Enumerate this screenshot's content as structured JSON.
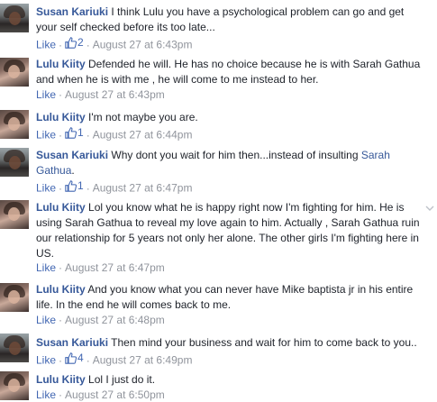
{
  "comments": [
    {
      "author": "Susan Kariuki",
      "avatar": "susan",
      "text": "I think Lulu you have a psychological problem can go and get your self checked before its too late...",
      "like_label": "Like",
      "reactions": "2",
      "timestamp": "August 27 at 6:43pm"
    },
    {
      "author": "Lulu Kiity",
      "avatar": "lulu",
      "text": "Defended he will. He has no choice because he is with Sarah Gathua and when he is with me , he will come to me instead to her.",
      "like_label": "Like",
      "reactions": "",
      "timestamp": "August 27 at 6:43pm"
    },
    {
      "author": "Lulu Kiity",
      "avatar": "lulu",
      "text": "I'm not maybe you are.",
      "like_label": "Like",
      "reactions": "1",
      "timestamp": "August 27 at 6:44pm"
    },
    {
      "author": "Susan Kariuki",
      "avatar": "susan",
      "text": "Why dont you wait for him then...instead of insulting ",
      "mention": "Sarah Gathua",
      "text_after": ".",
      "like_label": "Like",
      "reactions": "1",
      "timestamp": "August 27 at 6:47pm"
    },
    {
      "author": "Lulu Kiity",
      "avatar": "lulu",
      "text": "Lol you know what he is happy right now I'm fighting for him. He is using Sarah Gathua to reveal my love again to him. Actually , Sarah Gathua ruin our relationship for 5 years not only her alone. The other girls I'm fighting here in US.",
      "like_label": "Like",
      "reactions": "",
      "timestamp": "August 27 at 6:47pm"
    },
    {
      "author": "Lulu Kiity",
      "avatar": "lulu",
      "text": "And you know what you can never have Mike baptista jr in his entire life. In the end he will comes back to me.",
      "like_label": "Like",
      "reactions": "",
      "timestamp": "August 27 at 6:48pm"
    },
    {
      "author": "Susan Kariuki",
      "avatar": "susan",
      "text": "Then mind your business and wait for him to come back to you..",
      "like_label": "Like",
      "reactions": "4",
      "timestamp": "August 27 at 6:49pm"
    },
    {
      "author": "Lulu Kiity",
      "avatar": "lulu",
      "text": "Lol I just do it.",
      "like_label": "Like",
      "reactions": "",
      "timestamp": "August 27 at 6:50pm"
    }
  ],
  "colors": {
    "author": "#365899",
    "meta": "#90949c",
    "like": "#4267b2"
  },
  "icons": {
    "reaction": "thumbs-up-icon",
    "options": "chevron-down-icon"
  }
}
